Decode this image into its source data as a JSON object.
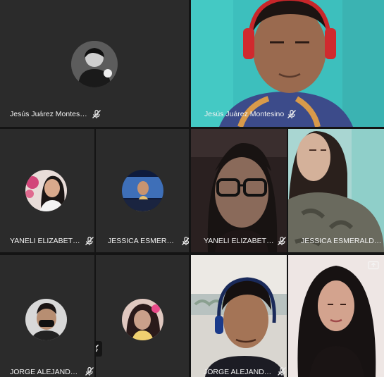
{
  "participants": [
    {
      "name": "Jesús Juárez Montesino",
      "video": false
    },
    {
      "name": "Jesús Juárez Montesino",
      "video": true
    },
    {
      "name": "YANELI ELIZABETH ...",
      "video": false
    },
    {
      "name": "JESSICA ESMERAL...",
      "video": false
    },
    {
      "name": "YANELI ELIZABETH ...",
      "video": true
    },
    {
      "name": "JESSICA ESMERALDA G...",
      "video": true
    },
    {
      "name": "JORGE ALEJANDRO...",
      "video": false
    },
    {
      "name": "",
      "video": false
    },
    {
      "name": "JORGE ALEJANDRO...",
      "video": true
    },
    {
      "name": "",
      "video": true
    }
  ],
  "icons": {
    "mic_muted": "mic-muted-icon",
    "present": "present-to-all-icon"
  },
  "colors": {
    "tile_bg": "#2b2b2b",
    "page_bg": "#141414",
    "label": "#f2f2f2"
  }
}
